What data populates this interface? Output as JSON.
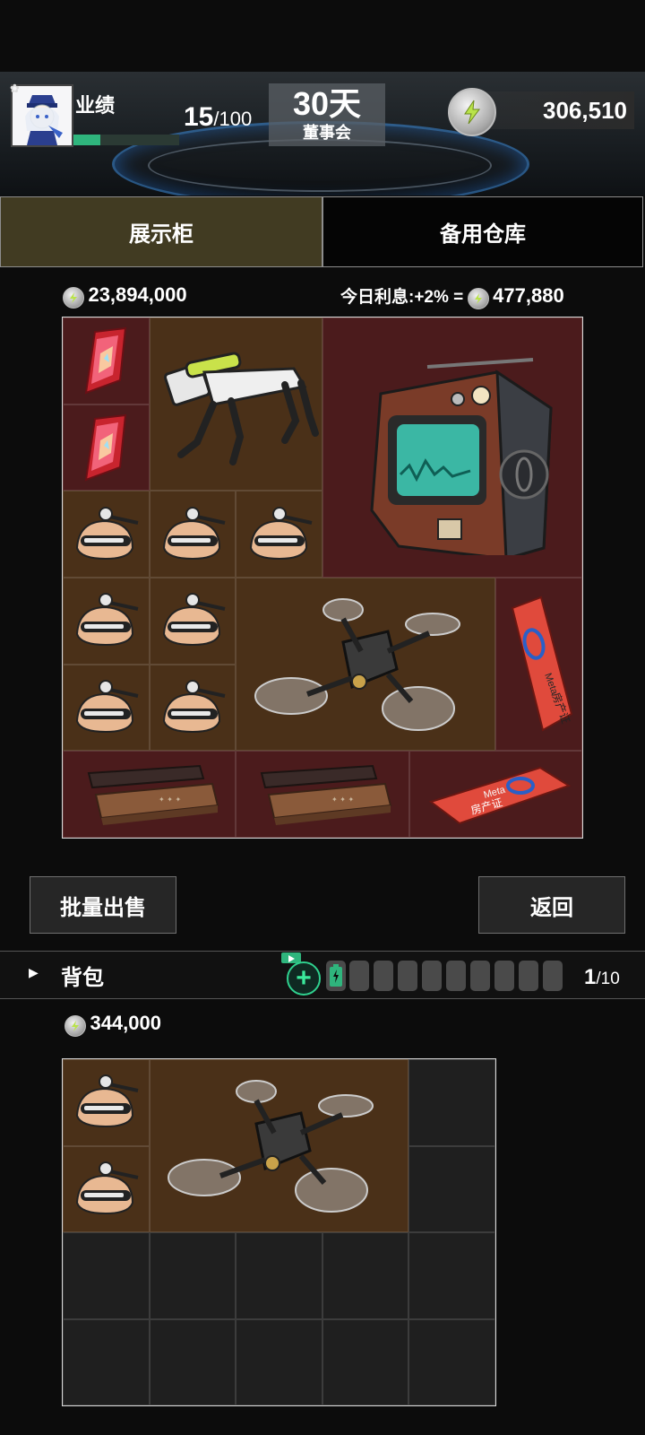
{
  "header": {
    "performance_label": "业绩",
    "performance_current": "15",
    "performance_max": "/100",
    "performance_progress": 0.15,
    "days": "30天",
    "board_label": "董事会",
    "money": "306,510"
  },
  "tabs": [
    {
      "label": "展示柜",
      "active": true
    },
    {
      "label": "备用仓库",
      "active": false
    }
  ],
  "showcase": {
    "total_value": "23,894,000",
    "interest_label": "今日利息:+2% =",
    "interest_value": "477,880"
  },
  "buttons": {
    "bulk_sell": "批量出售",
    "back": "返回"
  },
  "backpack": {
    "label": "背包",
    "capacity": "1",
    "capacity_max": "/10",
    "value": "344,000"
  },
  "items": {
    "property_card_text": "房产证",
    "meta_text": "Meta"
  },
  "colors": {
    "cell_red": "#4b1b1c",
    "cell_brown": "#4a3018",
    "accent_green": "#2fb57d",
    "tab_active": "#413b22"
  }
}
